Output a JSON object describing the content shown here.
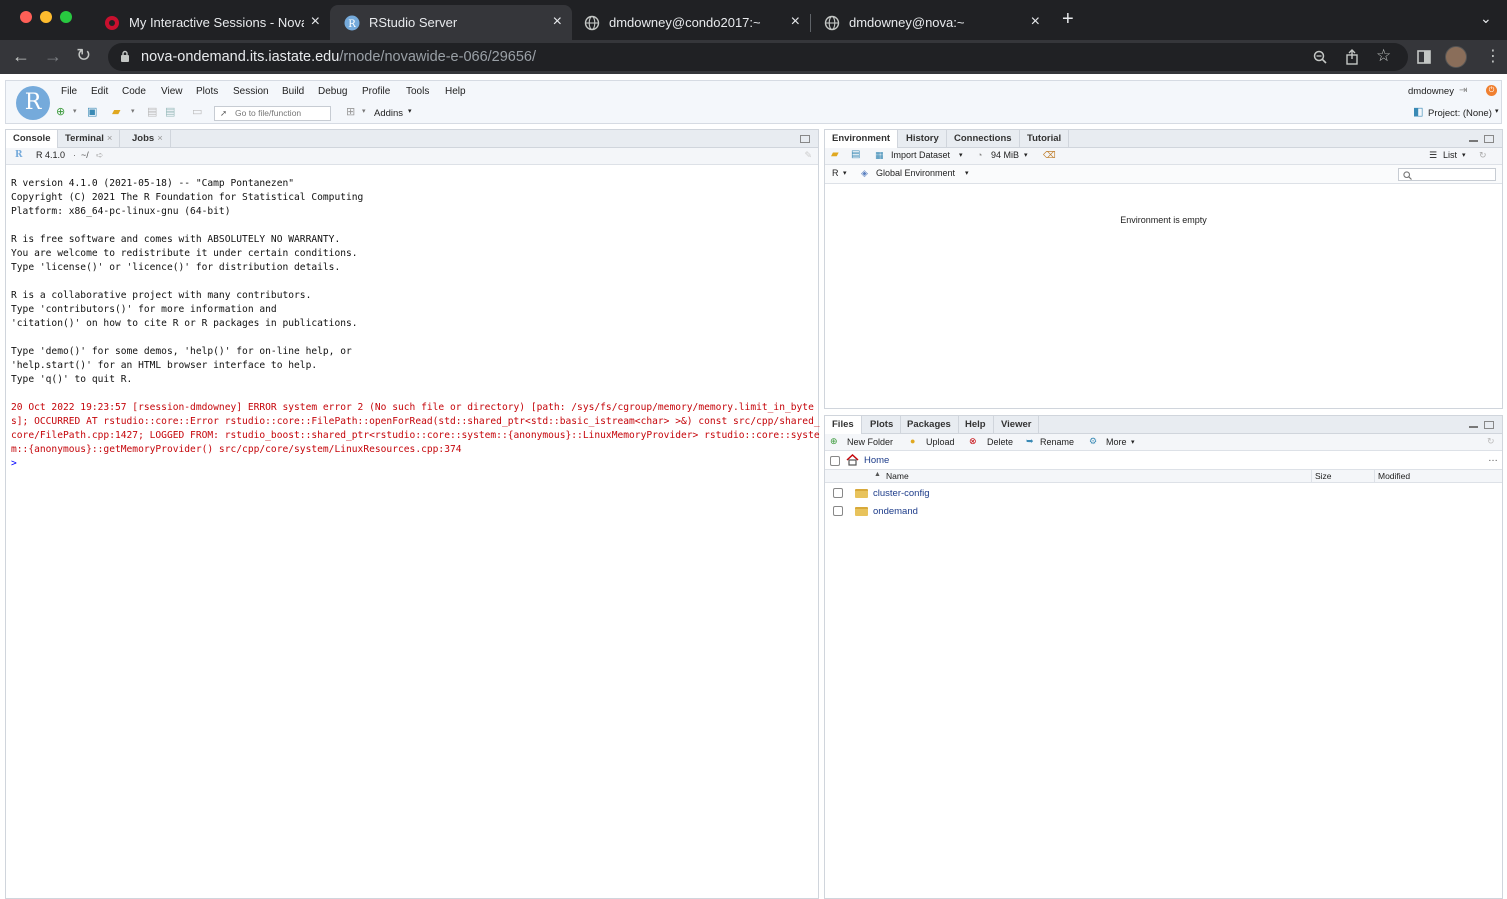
{
  "browser": {
    "tabs": [
      {
        "title": "My Interactive Sessions - Nova",
        "icon": "ondemand-logo-icon"
      },
      {
        "title": "RStudio Server",
        "icon": "rstudio-r-icon"
      },
      {
        "title": "dmdowney@condo2017:~",
        "icon": "globe-icon"
      },
      {
        "title": "dmdowney@nova:~",
        "icon": "globe-icon"
      }
    ],
    "url_host": "nova-ondemand.its.iastate.edu",
    "url_path": "/rnode/novawide-e-066/29656/"
  },
  "rstudio": {
    "menu": [
      "File",
      "Edit",
      "Code",
      "View",
      "Plots",
      "Session",
      "Build",
      "Debug",
      "Profile",
      "Tools",
      "Help"
    ],
    "username": "dmdowney",
    "goto_placeholder": "Go to file/function",
    "addins_label": "Addins",
    "project_label": "Project: (None)",
    "logo_letter": "R"
  },
  "console_pane": {
    "tabs": [
      {
        "label": "Console"
      },
      {
        "label": "Terminal"
      },
      {
        "label": "Jobs"
      }
    ],
    "r_version": "R 4.1.0",
    "wd": "~/",
    "lines": [
      {
        "text": "R version 4.1.0 (2021-05-18) -- \"Camp Pontanezen\"",
        "kind": "normal"
      },
      {
        "text": "Copyright (C) 2021 The R Foundation for Statistical Computing",
        "kind": "normal"
      },
      {
        "text": "Platform: x86_64-pc-linux-gnu (64-bit)",
        "kind": "normal"
      },
      {
        "text": "",
        "kind": "normal"
      },
      {
        "text": "R is free software and comes with ABSOLUTELY NO WARRANTY.",
        "kind": "normal"
      },
      {
        "text": "You are welcome to redistribute it under certain conditions.",
        "kind": "normal"
      },
      {
        "text": "Type 'license()' or 'licence()' for distribution details.",
        "kind": "normal"
      },
      {
        "text": "",
        "kind": "normal"
      },
      {
        "text": "R is a collaborative project with many contributors.",
        "kind": "normal"
      },
      {
        "text": "Type 'contributors()' for more information and",
        "kind": "normal"
      },
      {
        "text": "'citation()' on how to cite R or R packages in publications.",
        "kind": "normal"
      },
      {
        "text": "",
        "kind": "normal"
      },
      {
        "text": "Type 'demo()' for some demos, 'help()' for on-line help, or",
        "kind": "normal"
      },
      {
        "text": "'help.start()' for an HTML browser interface to help.",
        "kind": "normal"
      },
      {
        "text": "Type 'q()' to quit R.",
        "kind": "normal"
      },
      {
        "text": "",
        "kind": "normal"
      },
      {
        "text": "20 Oct 2022 19:23:57 [rsession-dmdowney] ERROR system error 2 (No such file or directory) [path: /sys/fs/cgroup/memory/memory.limit_in_byte",
        "kind": "error"
      },
      {
        "text": "s]; OCCURRED AT rstudio::core::Error rstudio::core::FilePath::openForRead(std::shared_ptr<std::basic_istream<char> >&) const src/cpp/shared_",
        "kind": "error"
      },
      {
        "text": "core/FilePath.cpp:1427; LOGGED FROM: rstudio_boost::shared_ptr<rstudio::core::system::{anonymous}::LinuxMemoryProvider> rstudio::core::syste",
        "kind": "error"
      },
      {
        "text": "m::{anonymous}::getMemoryProvider() src/cpp/core/system/LinuxResources.cpp:374",
        "kind": "error"
      },
      {
        "text": ">",
        "kind": "prompt"
      }
    ]
  },
  "env_pane": {
    "tabs": [
      {
        "label": "Environment"
      },
      {
        "label": "History"
      },
      {
        "label": "Connections"
      },
      {
        "label": "Tutorial"
      }
    ],
    "import_label": "Import Dataset",
    "memory_label": "94 MiB",
    "list_label": "List",
    "lang_label": "R",
    "scope_label": "Global Environment",
    "empty_message": "Environment is empty"
  },
  "files_pane": {
    "tabs": [
      {
        "label": "Files"
      },
      {
        "label": "Plots"
      },
      {
        "label": "Packages"
      },
      {
        "label": "Help"
      },
      {
        "label": "Viewer"
      }
    ],
    "toolbar": {
      "new_folder": "New Folder",
      "upload": "Upload",
      "delete": "Delete",
      "rename": "Rename",
      "more": "More"
    },
    "breadcrumb": "Home",
    "columns": {
      "name": "Name",
      "size": "Size",
      "modified": "Modified"
    },
    "files": [
      {
        "name": "cluster-config"
      },
      {
        "name": "ondemand"
      }
    ]
  },
  "colors": {
    "accent": "#75aadb",
    "error": "#c5060b",
    "link": "#1d3c8a"
  }
}
